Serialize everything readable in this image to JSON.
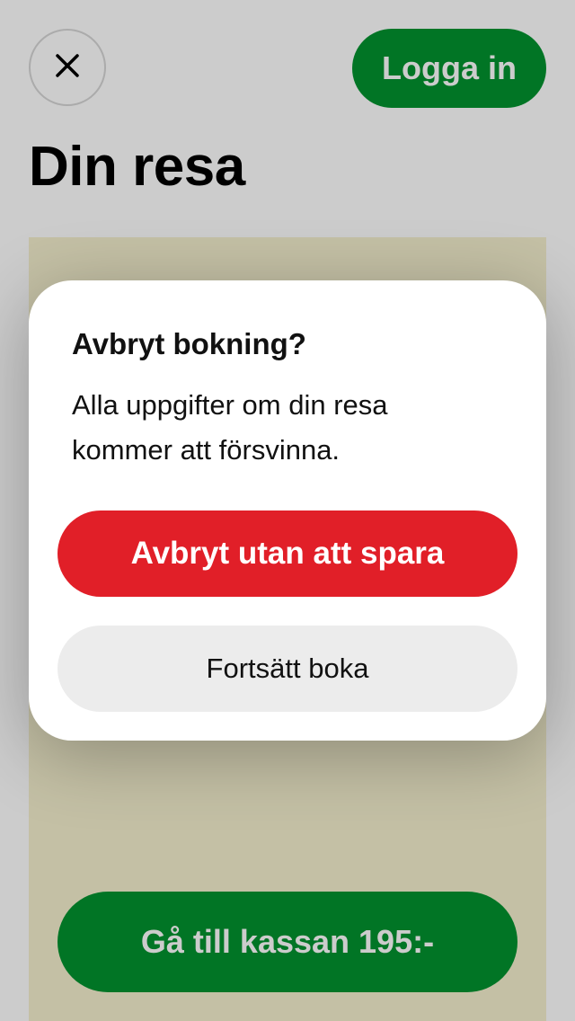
{
  "header": {
    "close_icon": "close-icon",
    "login_label": "Logga in"
  },
  "page": {
    "title": "Din resa"
  },
  "footer": {
    "checkout_label": "Gå till kassan 195:-"
  },
  "dialog": {
    "title": "Avbryt bokning?",
    "body": "Alla uppgifter om din resa kommer att försvinna.",
    "cancel_label": "Avbryt utan att spara",
    "continue_label": "Fortsätt boka"
  },
  "colors": {
    "brand_green": "#02932f",
    "danger_red": "#e11f28",
    "secondary_gray": "#ececec",
    "panel_beige": "#f5f0cf"
  }
}
